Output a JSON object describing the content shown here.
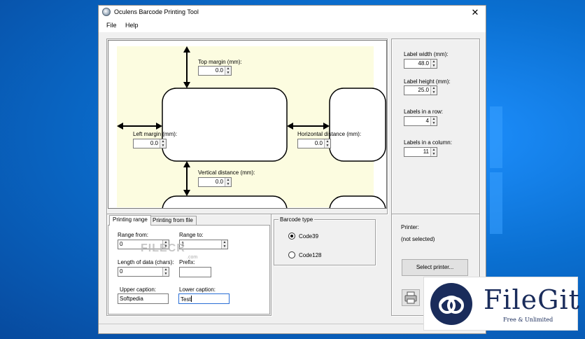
{
  "window": {
    "title": "Oculens Barcode Printing Tool",
    "close_glyph": "✕"
  },
  "menu": {
    "file": "File",
    "help": "Help"
  },
  "layout_panel": {
    "top_margin_label": "Top margin (mm):",
    "top_margin_value": "0.0",
    "left_margin_label": "Left margin (mm):",
    "left_margin_value": "0.0",
    "horizontal_distance_label": "Horizontal distance (mm):",
    "horizontal_distance_value": "0.0",
    "vertical_distance_label": "Vertical distance (mm):",
    "vertical_distance_value": "0.0"
  },
  "size_panel": {
    "label_width_label": "Label width (mm):",
    "label_width_value": "48.0",
    "label_height_label": "Label height (mm):",
    "label_height_value": "25.0",
    "labels_in_row_label": "Labels in a row:",
    "labels_in_row_value": "4",
    "labels_in_column_label": "Labels in a column:",
    "labels_in_column_value": "11"
  },
  "tabs": [
    {
      "label": "Printing range",
      "active": true
    },
    {
      "label": "Printing from file",
      "active": false
    }
  ],
  "printing_range": {
    "range_from_label": "Range from:",
    "range_from_value": "0",
    "range_to_label": "Range to:",
    "range_to_value": "1",
    "length_label": "Length of data (chars):",
    "length_value": "0",
    "prefix_label": "Prefix:",
    "prefix_value": "",
    "upper_caption_label": "Upper caption:",
    "upper_caption_value": "Softpedia",
    "lower_caption_label": "Lower caption:",
    "lower_caption_value": "Test"
  },
  "barcode_type": {
    "group_label": "Barcode type",
    "options": [
      {
        "label": "Code39",
        "checked": true
      },
      {
        "label": "Code128",
        "checked": false
      }
    ]
  },
  "printer": {
    "label": "Printer:",
    "status": "(not selected)",
    "select_button": "Select printer...",
    "print_icon": "printer-icon"
  },
  "watermark": {
    "text": "FILECR",
    "sub": ".com"
  },
  "brand": {
    "name": "FileGit",
    "tagline": "Free & Unlimited"
  },
  "colors": {
    "label_area": "#fcfce0",
    "desktop": "#0a74d4",
    "brand": "#1a2c5b"
  }
}
